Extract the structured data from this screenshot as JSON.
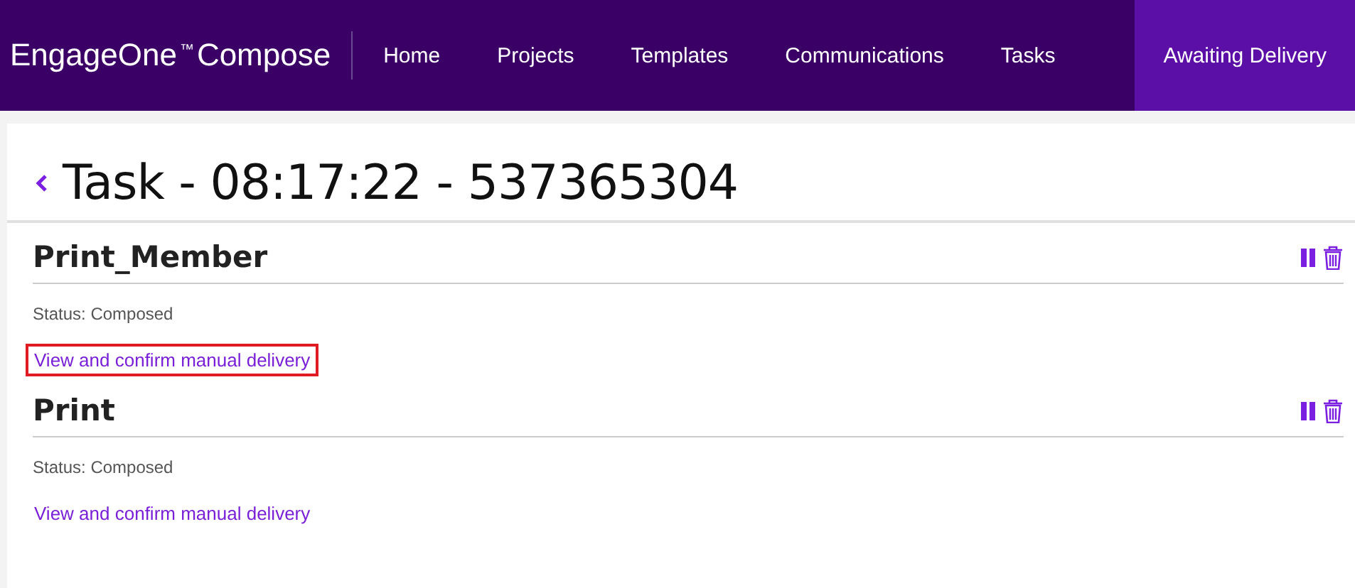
{
  "brand": {
    "name": "EngageOne",
    "mark": "™",
    "product": "Compose"
  },
  "nav": [
    {
      "label": "Home",
      "selected": false
    },
    {
      "label": "Projects",
      "selected": false
    },
    {
      "label": "Templates",
      "selected": false
    },
    {
      "label": "Communications",
      "selected": false
    },
    {
      "label": "Tasks",
      "selected": false
    },
    {
      "label": "Awaiting Delivery",
      "selected": true
    }
  ],
  "page_title": "Task - 08:17:22 - 537365304",
  "deliveries": [
    {
      "name": "Print_Member",
      "status": "Status: Composed",
      "link": "View and confirm manual delivery",
      "highlighted": true
    },
    {
      "name": "Print",
      "status": "Status: Composed",
      "link": "View and confirm manual delivery",
      "highlighted": false
    }
  ]
}
